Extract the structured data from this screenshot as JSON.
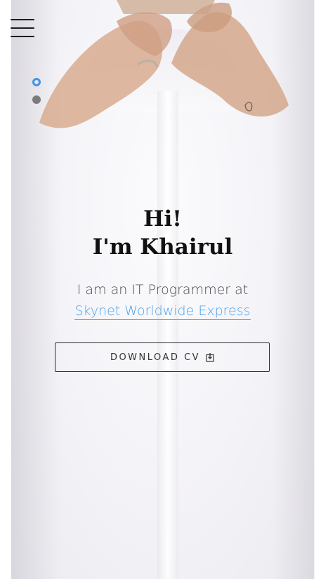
{
  "hero": {
    "image": "man-buttoning-white-shirt-photo"
  },
  "nav": {
    "menu_icon": "hamburger-menu-icon"
  },
  "slider": {
    "dots": [
      {
        "state": "active",
        "color": "#3f96e8"
      },
      {
        "state": "inactive",
        "color": "#7b7b7d"
      }
    ]
  },
  "intro": {
    "greeting": "Hi!",
    "name_line": "I'm Khairul",
    "role_text": "I am an IT Programmer at",
    "company": "Skynet Worldwide Express",
    "link_color": "#4aa3ec"
  },
  "cta": {
    "label": "DOWNLOAD CV",
    "icon": "download-icon"
  }
}
